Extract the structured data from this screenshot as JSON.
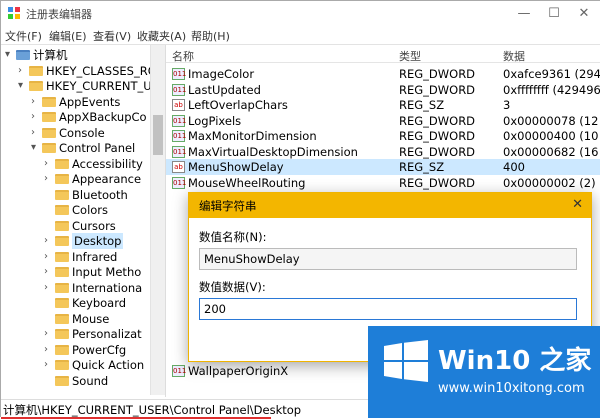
{
  "window": {
    "title": "注册表编辑器",
    "min_icon": "minimize-icon",
    "max_icon": "maximize-icon",
    "close_icon": "close-icon"
  },
  "menu": [
    "文件(F)",
    "编辑(E)",
    "查看(V)",
    "收藏夹(A)",
    "帮助(H)"
  ],
  "tree": [
    {
      "label": "计算机",
      "indent": 0,
      "arrow": "▾"
    },
    {
      "label": "HKEY_CLASSES_RO",
      "indent": 1,
      "arrow": "›"
    },
    {
      "label": "HKEY_CURRENT_U",
      "indent": 1,
      "arrow": "▾"
    },
    {
      "label": "AppEvents",
      "indent": 2,
      "arrow": "›"
    },
    {
      "label": "AppXBackupCo",
      "indent": 2,
      "arrow": "›"
    },
    {
      "label": "Console",
      "indent": 2,
      "arrow": "›"
    },
    {
      "label": "Control Panel",
      "indent": 2,
      "arrow": "▾"
    },
    {
      "label": "Accessibility",
      "indent": 3,
      "arrow": "›"
    },
    {
      "label": "Appearance",
      "indent": 3,
      "arrow": "›"
    },
    {
      "label": "Bluetooth",
      "indent": 3,
      "arrow": ""
    },
    {
      "label": "Colors",
      "indent": 3,
      "arrow": ""
    },
    {
      "label": "Cursors",
      "indent": 3,
      "arrow": ""
    },
    {
      "label": "Desktop",
      "indent": 3,
      "arrow": "›",
      "selected": true
    },
    {
      "label": "Infrared",
      "indent": 3,
      "arrow": "›"
    },
    {
      "label": "Input Metho",
      "indent": 3,
      "arrow": "›"
    },
    {
      "label": "Internationa",
      "indent": 3,
      "arrow": "›"
    },
    {
      "label": "Keyboard",
      "indent": 3,
      "arrow": ""
    },
    {
      "label": "Mouse",
      "indent": 3,
      "arrow": ""
    },
    {
      "label": "Personalizat",
      "indent": 3,
      "arrow": "›"
    },
    {
      "label": "PowerCfg",
      "indent": 3,
      "arrow": "›"
    },
    {
      "label": "Quick Action",
      "indent": 3,
      "arrow": "›"
    },
    {
      "label": "Sound",
      "indent": 3,
      "arrow": ""
    }
  ],
  "list_header": {
    "name": "名称",
    "type": "类型",
    "data": "数据"
  },
  "rows": [
    {
      "name": "ImageColor",
      "type": "REG_DWORD",
      "data": "0xafce9361 (294",
      "icon": "dword"
    },
    {
      "name": "LastUpdated",
      "type": "REG_DWORD",
      "data": "0xffffffff (429496",
      "icon": "dword"
    },
    {
      "name": "LeftOverlapChars",
      "type": "REG_SZ",
      "data": "3",
      "icon": "sz"
    },
    {
      "name": "LogPixels",
      "type": "REG_DWORD",
      "data": "0x00000078 (12",
      "icon": "dword"
    },
    {
      "name": "MaxMonitorDimension",
      "type": "REG_DWORD",
      "data": "0x00000400 (10",
      "icon": "dword"
    },
    {
      "name": "MaxVirtualDesktopDimension",
      "type": "REG_DWORD",
      "data": "0x00000682 (16",
      "icon": "dword"
    },
    {
      "name": "MenuShowDelay",
      "type": "REG_SZ",
      "data": "400",
      "icon": "sz",
      "selected": true
    },
    {
      "name": "MouseWheelRouting",
      "type": "REG_DWORD",
      "data": "0x00000002 (2)",
      "icon": "dword"
    }
  ],
  "rows_tail": [
    {
      "name": "WallpaperOriginX",
      "type": "",
      "data": "",
      "icon": "dword"
    }
  ],
  "status": {
    "path": "计算机\\HKEY_CURRENT_USER\\Control Panel\\Desktop"
  },
  "dialog": {
    "title": "编辑字符串",
    "name_label": "数值名称(N):",
    "name_value": "MenuShowDelay",
    "data_label": "数值数据(V):",
    "data_value": "200"
  },
  "watermark": {
    "brand": "Win10 之家",
    "url": "www.win10xitong.com"
  },
  "colors": {
    "accent": "#f3b600",
    "selection": "#cce8ff",
    "brand_blue": "#1e7ed8"
  }
}
